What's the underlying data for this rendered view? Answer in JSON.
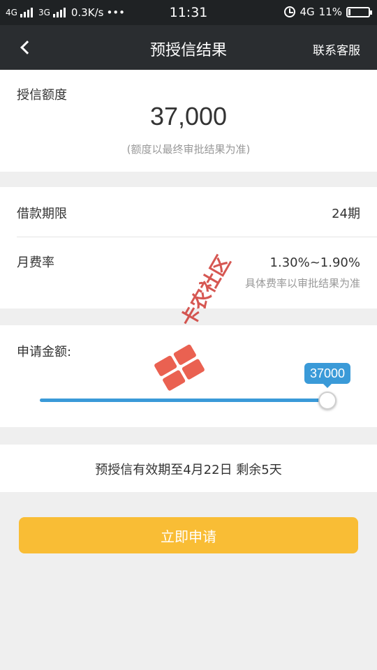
{
  "status_bar": {
    "net1": "4G",
    "net2": "3G",
    "speed": "0.3K/s",
    "dots": "•••",
    "time": "11:31",
    "net3": "4G",
    "battery": "11%",
    "battery_level": 0.11
  },
  "nav": {
    "title": "预授信结果",
    "contact": "联系客服"
  },
  "credit": {
    "label": "授信额度",
    "amount": "37,000",
    "note": "(额度以最终审批结果为准)"
  },
  "terms": {
    "period_label": "借款期限",
    "period_value": "24期",
    "rate_label": "月费率",
    "rate_value": "1.30%~1.90%",
    "rate_note": "具体费率以审批结果为准"
  },
  "amount": {
    "label": "申请金额:",
    "tooltip": "37000",
    "slider_fraction": 1.0
  },
  "validity": {
    "text": "预授信有效期至4月22日 剩余5天"
  },
  "apply_button": "立即申请",
  "watermark": {
    "text": "卡农社区"
  },
  "colors": {
    "accent": "#3a9ad8",
    "button": "#f9bd35",
    "nav_bg": "#2a2d30",
    "watermark": "#cf3a35"
  }
}
